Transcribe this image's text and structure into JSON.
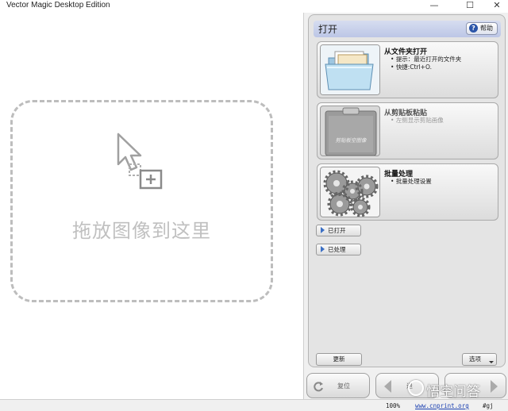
{
  "window": {
    "title": "Vector Magic Desktop Edition",
    "minimize_glyph": "—",
    "maximize_glyph": "☐",
    "close_glyph": "✕"
  },
  "dropzone": {
    "text": "拖放图像到这里",
    "icon": "drop-cursor-icon"
  },
  "panel": {
    "title": "打开",
    "help_label": "帮助",
    "help_icon": "question-icon",
    "cards": [
      {
        "title": "从文件夹打开",
        "bullets": [
          "提示：最近打开的文件夹",
          "快捷:Ctrl+O."
        ],
        "icon": "folder-icon",
        "enabled": true
      },
      {
        "title": "从剪贴板粘贴",
        "bullets": [
          "左侧显示剪贴画像"
        ],
        "icon": "clipboard-icon",
        "thumb_text": "剪贴板空图像",
        "enabled": false
      },
      {
        "title": "批量处理",
        "bullets": [
          "批量处理设置"
        ],
        "icon": "gears-icon",
        "enabled": true
      }
    ],
    "list_buttons": [
      {
        "label": "已打开",
        "icon": "play-arrow-icon"
      },
      {
        "label": "已处理",
        "icon": "play-arrow-icon"
      }
    ],
    "update_label": "更新",
    "options_label": "选项"
  },
  "nav": {
    "reset_label": "复位",
    "back_label": "退",
    "next_label": ""
  },
  "status": {
    "zoom": "100%",
    "link": "www.cnprint.org",
    "version": "#gj"
  },
  "watermark": {
    "text": "悟空问答"
  },
  "colors": {
    "header_blue": "#bcc6e6",
    "help_icon_blue": "#2a54a8",
    "arrow_blue": "#3b6fc4",
    "dropzone_gray": "#bdbdbd"
  }
}
